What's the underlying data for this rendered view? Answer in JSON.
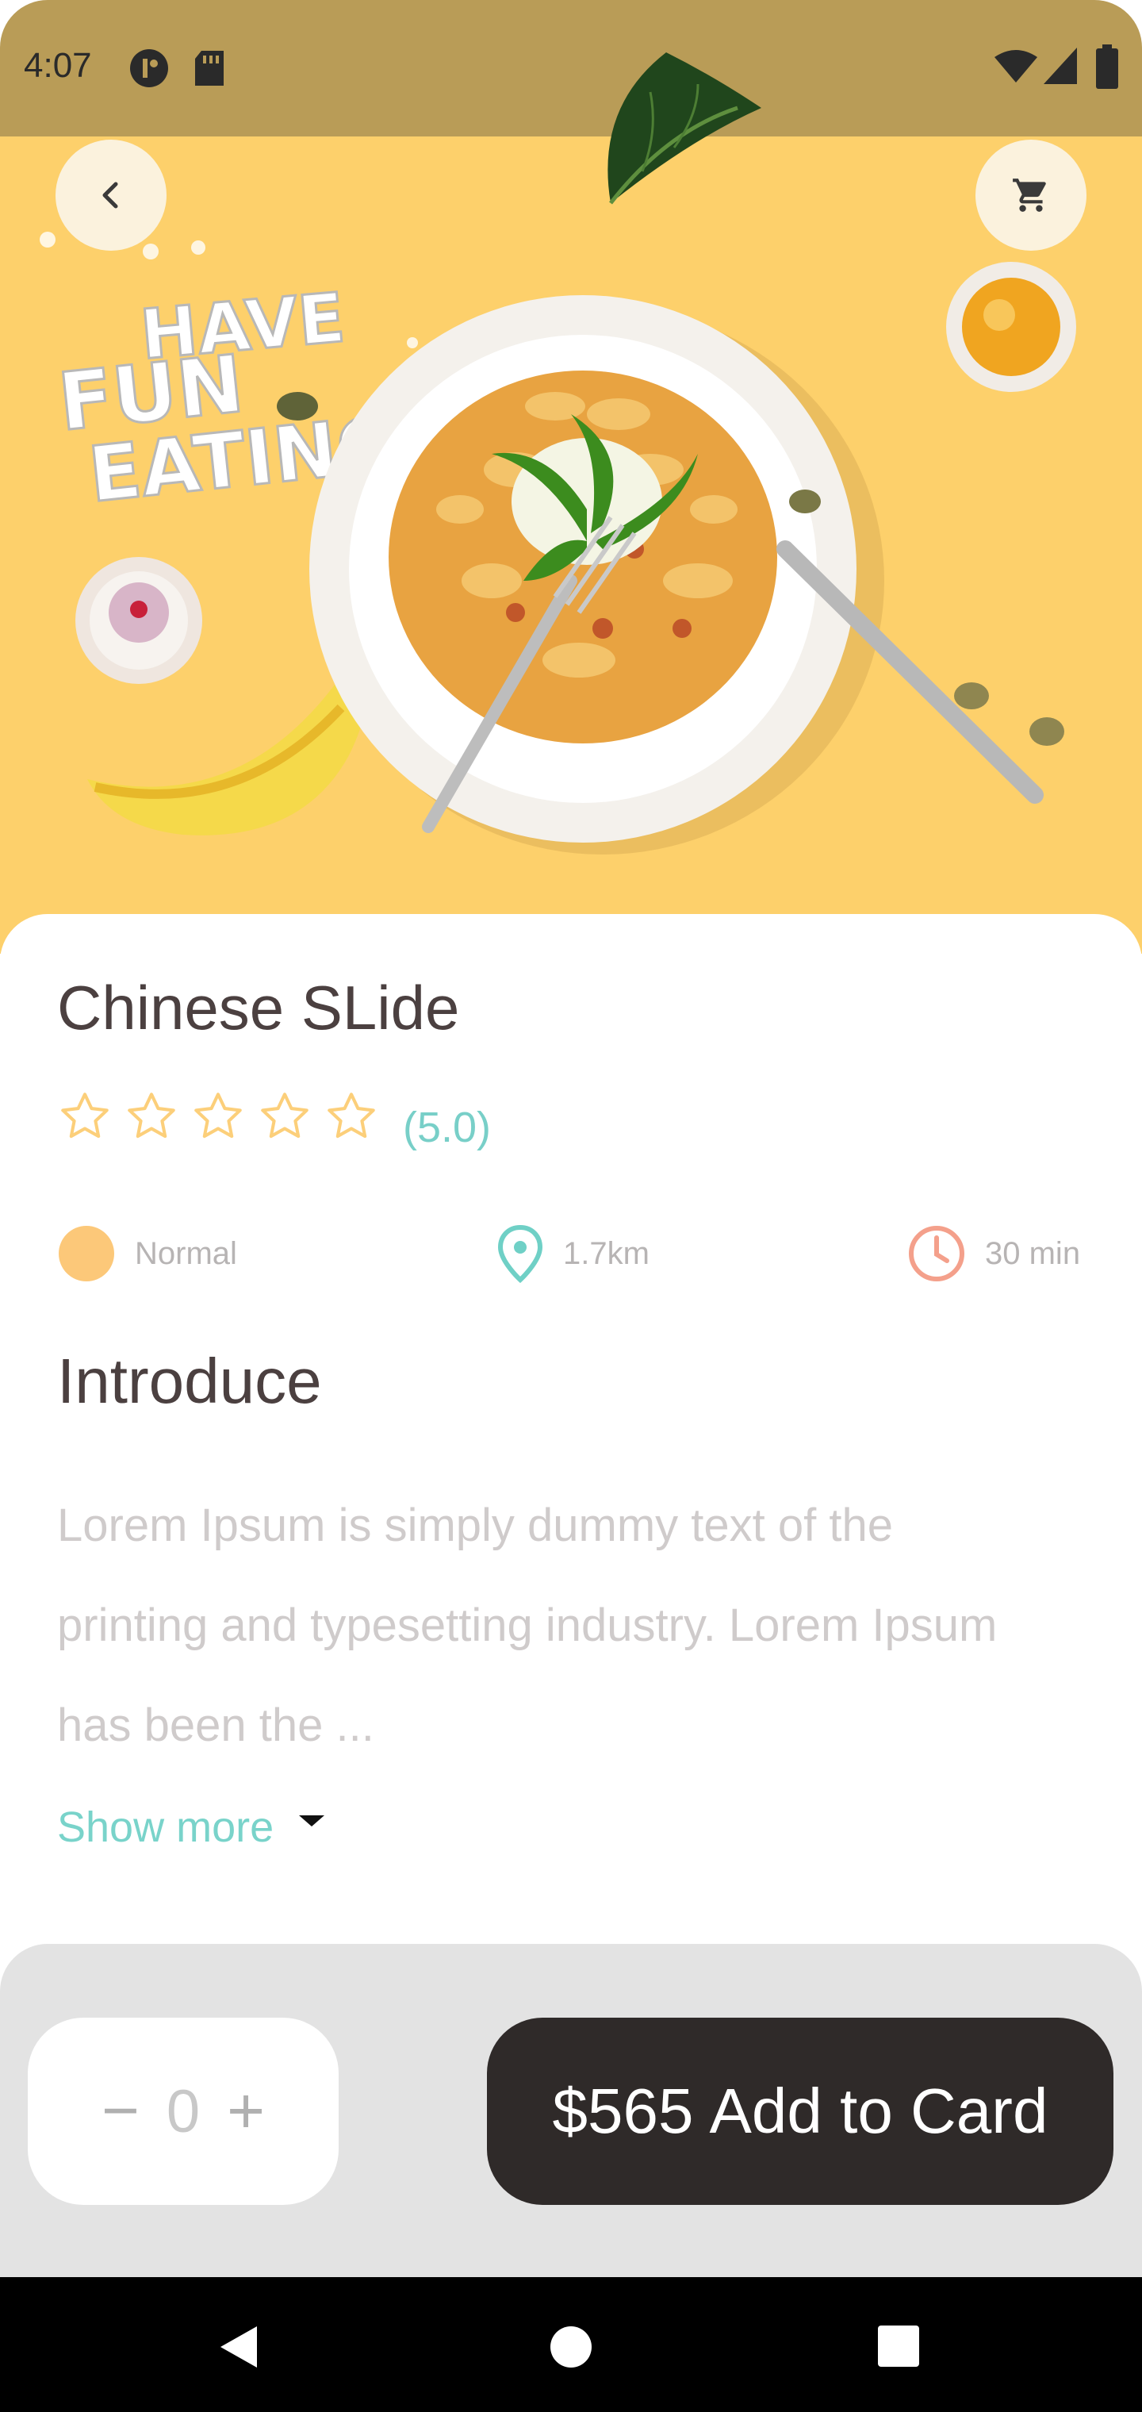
{
  "status_bar": {
    "time": "4:07"
  },
  "hero": {
    "banner_text": [
      "HAVE",
      "FUN",
      "EATING"
    ],
    "back_icon": "chevron-left-icon",
    "cart_icon": "cart-icon"
  },
  "product": {
    "title": "Chinese SLide",
    "rating_text": "(5.0)",
    "rating_value": 5.0,
    "stars": 5
  },
  "info": {
    "level": "Normal",
    "distance": "1.7km",
    "time": "30 min"
  },
  "intro": {
    "heading": "Introduce",
    "text": "Lorem Ipsum is simply dummy text of the printing and typesetting industry. Lorem Ipsum has been the ...",
    "show_more": "Show more"
  },
  "order": {
    "minus": "−",
    "quantity": "0",
    "plus": "+",
    "price": "$565",
    "add_label": "Add to Card"
  },
  "colors": {
    "status_bar": "#b99c57",
    "hero_bg": "#fdd06b",
    "accent": "#79d3ca",
    "star": "#fccf7a",
    "button_dark": "#2f2a29",
    "bottom_bg": "#e3e3e3"
  }
}
